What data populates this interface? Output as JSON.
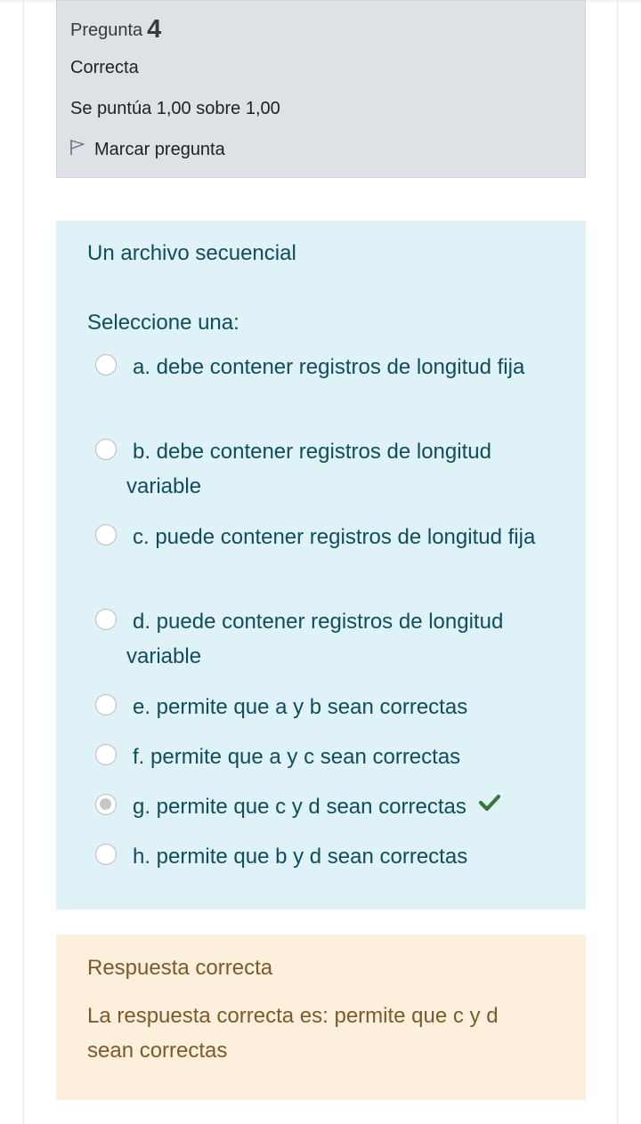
{
  "info": {
    "label": "Pregunta",
    "number": "4",
    "state": "Correcta",
    "grade": "Se puntúa 1,00 sobre 1,00",
    "flag_label": "Marcar pregunta"
  },
  "formulation": {
    "question_text": "Un archivo secuencial",
    "prompt": "Seleccione una:",
    "options": [
      {
        "text": "a. debe contener registros de longitud fija",
        "selected": false
      },
      {
        "text": "b. debe contener registros de longitud variable",
        "selected": false
      },
      {
        "text": "c. puede contener registros de longitud fija",
        "selected": false
      },
      {
        "text": "d. puede contener registros de longitud variable",
        "selected": false
      },
      {
        "text": "e. permite que a y b sean correctas",
        "selected": false
      },
      {
        "text": "f. permite que a y c sean correctas",
        "selected": false
      },
      {
        "text": "g. permite que c y d sean correctas",
        "selected": true
      },
      {
        "text": "h. permite que b y d sean correctas",
        "selected": false
      }
    ]
  },
  "feedback": {
    "title": "Respuesta correcta",
    "right_answer": "La respuesta correcta es: permite que c y d sean correctas"
  },
  "colors": {
    "info_bg": "#dee2e6",
    "formulation_bg": "#def2f8",
    "formulation_text": "#0f4e5a",
    "feedback_bg": "#fcefdc",
    "feedback_text": "#7d5a29",
    "correct_check": "#357a32"
  },
  "icons": {
    "flag": "flag-outline-icon",
    "correct": "check-icon"
  }
}
